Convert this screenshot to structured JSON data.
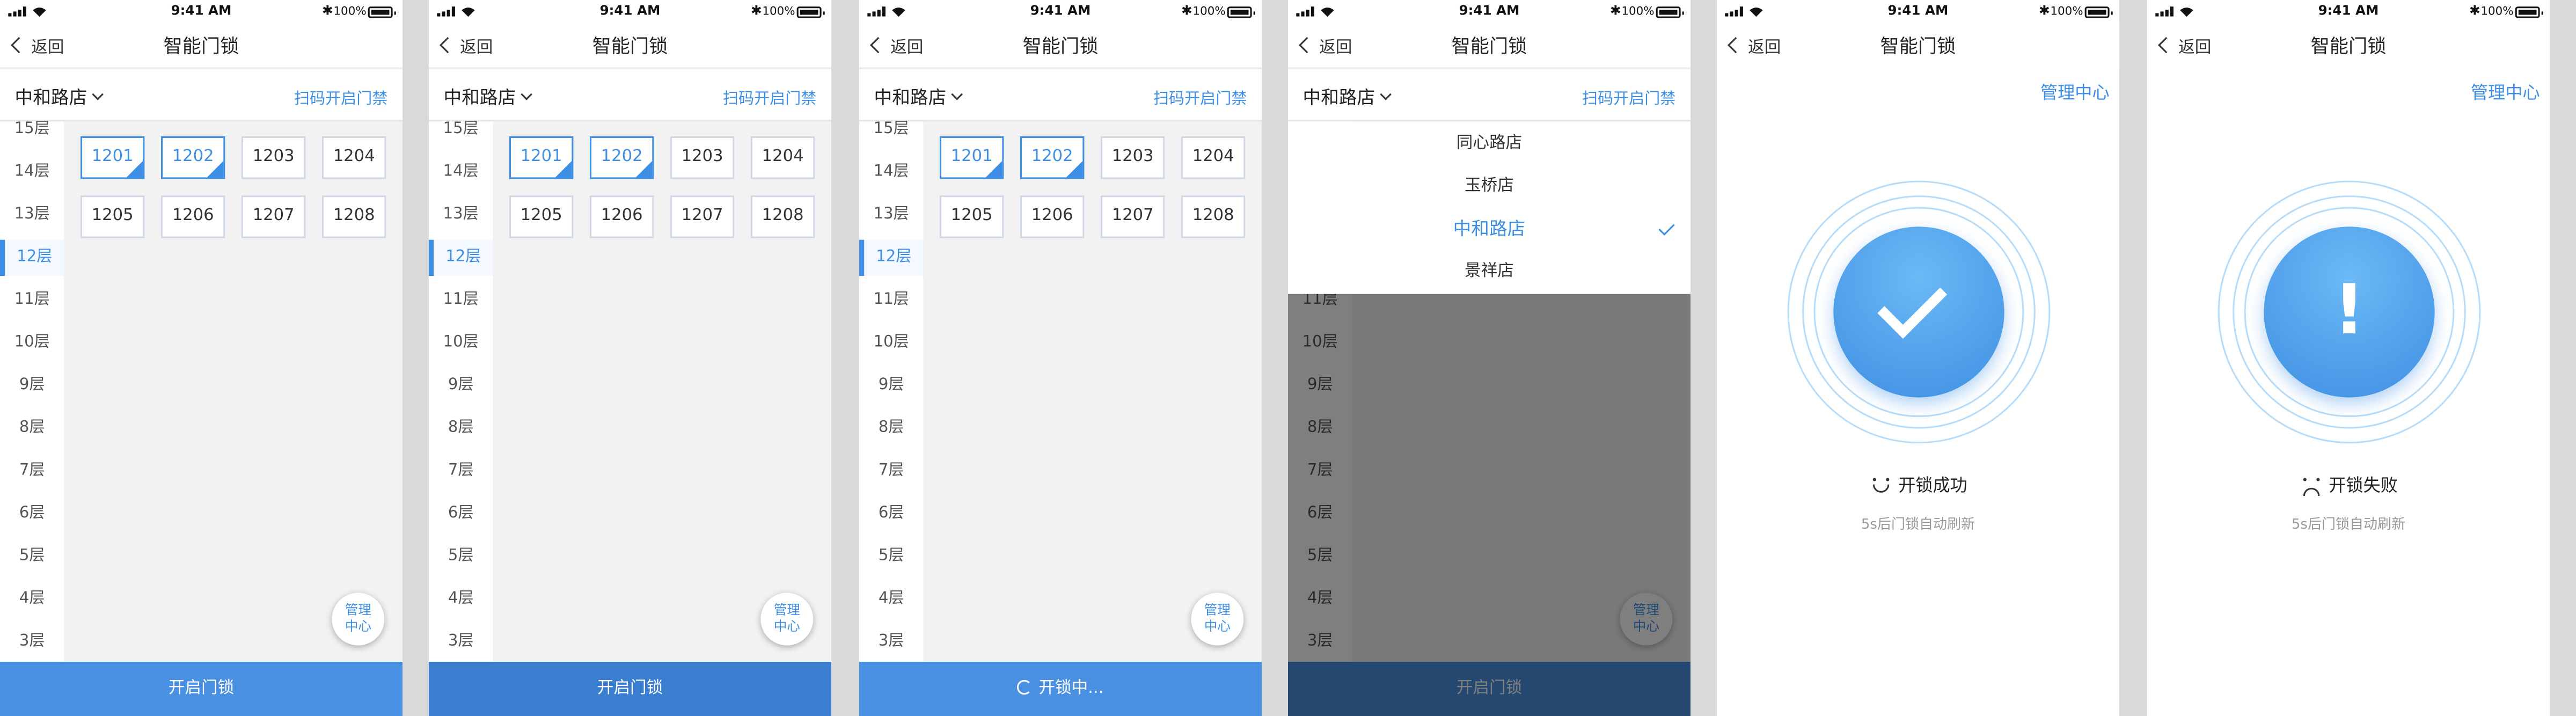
{
  "status": {
    "time": "9:41 AM",
    "battery": "100%",
    "bluetooth": "✱"
  },
  "nav": {
    "back": "返回",
    "title": "智能门锁"
  },
  "store": {
    "selected": "中和路店",
    "scan": "扫码开启门禁"
  },
  "floors": [
    "15层",
    "14层",
    "13层",
    "12层",
    "11层",
    "10层",
    "9层",
    "8层",
    "7层",
    "6层",
    "5层",
    "4层",
    "3层"
  ],
  "active_floor": "12层",
  "rooms": [
    "1201",
    "1202",
    "1203",
    "1204",
    "1205",
    "1206",
    "1207",
    "1208"
  ],
  "selected_rooms": [
    "1201",
    "1202"
  ],
  "manage_fab": {
    "line1": "管理",
    "line2": "中心"
  },
  "buttons": {
    "open": "开启门锁",
    "opening": "开锁中..."
  },
  "store_list": [
    "同心路店",
    "玉桥店",
    "中和路店",
    "景祥店"
  ],
  "manage_center": "管理中心",
  "result": {
    "success": "开锁成功",
    "fail": "开锁失败",
    "refresh": "5s后门锁自动刷新"
  },
  "colors": {
    "accent": "#3d8fe6",
    "button": "#4a90e2",
    "panel": "#f2f2f2"
  }
}
